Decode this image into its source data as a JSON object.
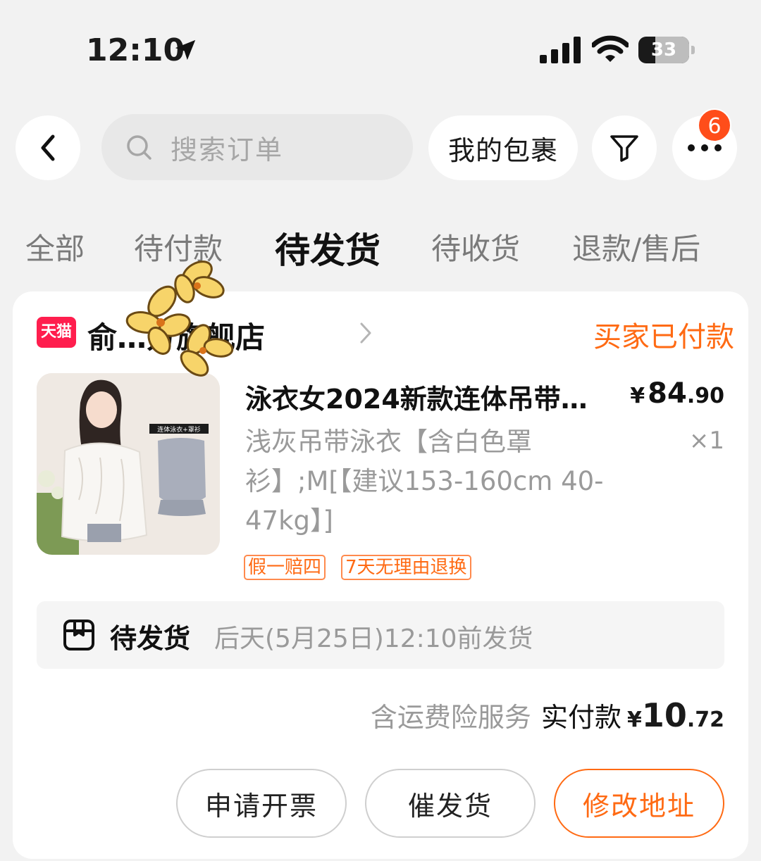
{
  "status_bar": {
    "time": "12:10",
    "battery": "33"
  },
  "header": {
    "search_placeholder": "搜索订单",
    "parcel_label": "我的包裹",
    "more_badge": "6"
  },
  "tabs": [
    {
      "label": "全部"
    },
    {
      "label": "待付款"
    },
    {
      "label": "待发货"
    },
    {
      "label": "待收货"
    },
    {
      "label": "退款/售后"
    }
  ],
  "order": {
    "platform_badge": "天猫",
    "shop_name": "俞…方旗舰店",
    "status": "买家已付款",
    "product": {
      "title": "泳衣女2024新款连体吊带…",
      "price_int": "84",
      "price_dec": ".90",
      "currency": "¥",
      "sku": "浅灰吊带泳衣【含白色罩衫】;M[【建议153-160cm 40-47kg】]",
      "quantity": "×1",
      "image_caption": "连体泳衣+罩衫",
      "tags": [
        "假一赔四",
        "7天无理由退换"
      ]
    },
    "shipping": {
      "label": "待发货",
      "text": "后天(5月25日)12:10前发货"
    },
    "payment": {
      "insurance": "含运费险服务",
      "paid_label": "实付款",
      "currency": "¥",
      "amount_int": "10",
      "amount_dec": ".72"
    },
    "actions": {
      "invoice": "申请开票",
      "urge": "催发货",
      "address": "修改地址"
    }
  },
  "colors": {
    "accent": "#ff6a13",
    "tmall_red": "#ff1e4e",
    "badge": "#ff4d1a",
    "background": "#f2f2f2"
  }
}
